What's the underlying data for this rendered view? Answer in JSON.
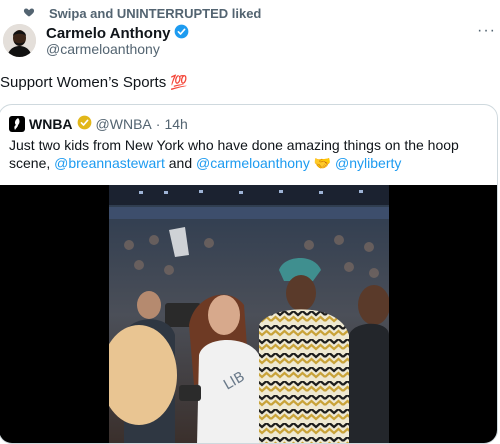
{
  "social_context": {
    "icon": "heart-icon",
    "text": "Swipa and UNINTERRUPTED liked"
  },
  "author": {
    "name": "Carmelo Anthony",
    "handle": "@carmeloanthony",
    "verified_color": "#1d9bf0",
    "more_label": "···"
  },
  "tweet": {
    "text": "Support Women’s Sports",
    "emoji": "💯"
  },
  "quote": {
    "name": "WNBA",
    "handle": "@WNBA",
    "separator": "·",
    "time": "14h",
    "badge_color": "#e2b719",
    "text_parts": [
      "Just two kids from New York who have done amazing things on the hoop scene, ",
      "@breannastewart",
      " and ",
      "@carmeloanthony",
      " 🤝 ",
      "@nyliberty"
    ]
  },
  "colors": {
    "mention": "#1d9bf0",
    "muted": "#536471",
    "border": "#cfd9de"
  }
}
